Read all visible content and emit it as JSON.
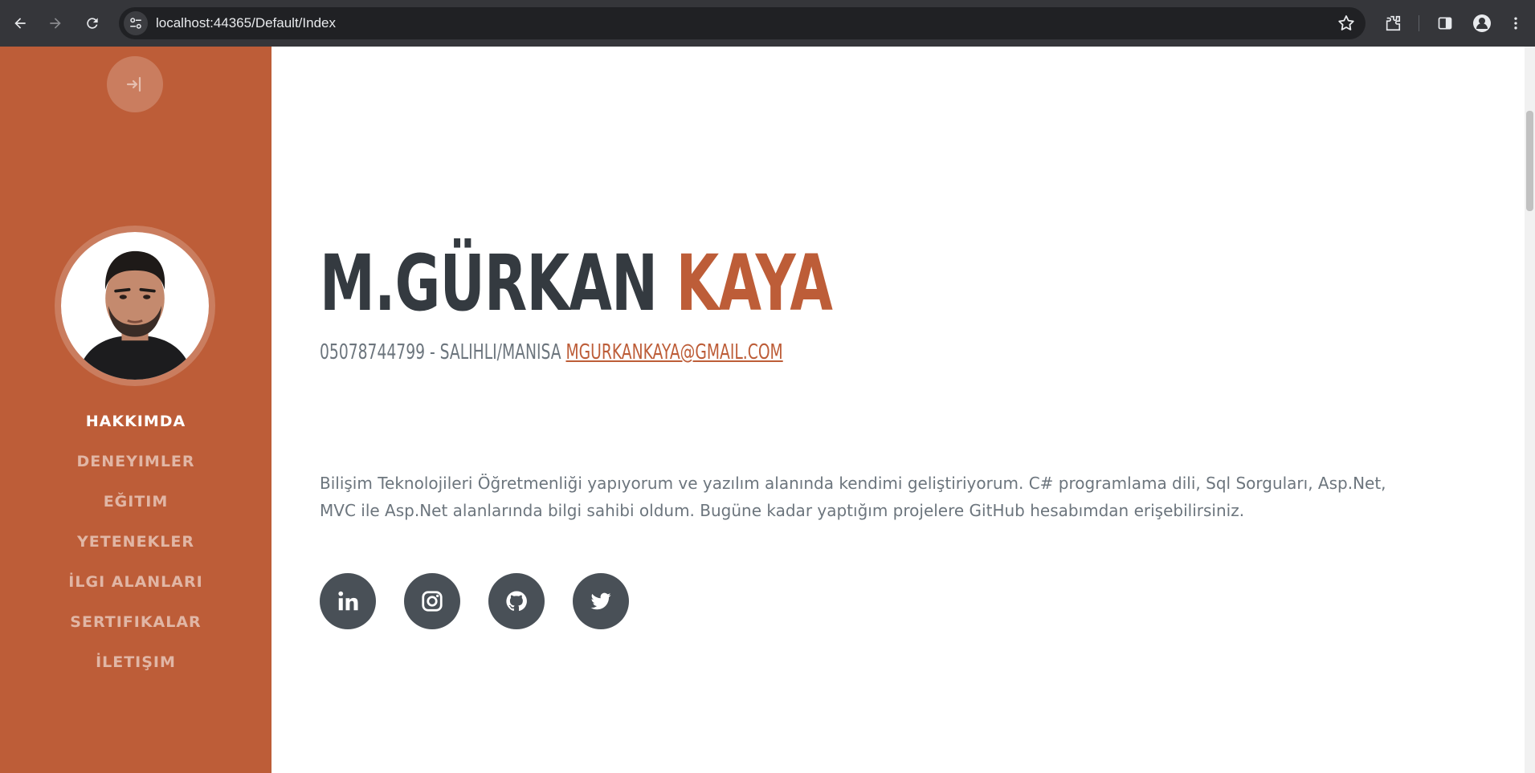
{
  "browser": {
    "url": "localhost:44365/Default/Index",
    "icons": [
      "back-icon",
      "forward-icon",
      "reload-icon",
      "site-settings-icon",
      "bookmark-star-icon",
      "extensions-icon",
      "side-panel-icon",
      "profile-icon",
      "menu-icon"
    ]
  },
  "sidebar": {
    "login_icon": "login-icon",
    "nav": [
      {
        "label": "HAKKIMDA"
      },
      {
        "label": "DENEYIMLER"
      },
      {
        "label": "EĞITIM"
      },
      {
        "label": "YETENEKLER"
      },
      {
        "label": "İLGI ALANLARI"
      },
      {
        "label": "SERTIFIKALAR"
      },
      {
        "label": "İLETIŞIM"
      }
    ],
    "active_index": 0
  },
  "main": {
    "first_name": "M.GÜRKAN",
    "last_name": "KAYA",
    "contact_prefix": "05078744799 - SALIHLI/MANISA",
    "email": "MGURKANKAYA@GMAIL.COM",
    "bio": "Bilişim Teknolojileri Öğretmenliği yapıyorum ve yazılım alanında kendimi geliştiriyorum. C# programlama dili, Sql Sorguları, Asp.Net, MVC ile Asp.Net alanlarında bilgi sahibi oldum. Bugüne kadar yaptığım projelere GitHub hesabımdan erişebilirsiniz.",
    "social": [
      "linkedin-icon",
      "instagram-icon",
      "github-icon",
      "twitter-icon"
    ]
  },
  "colors": {
    "primary": "#bd5d38",
    "dark": "#343a40",
    "muted": "#6c757d",
    "social_bg": "#495057"
  }
}
